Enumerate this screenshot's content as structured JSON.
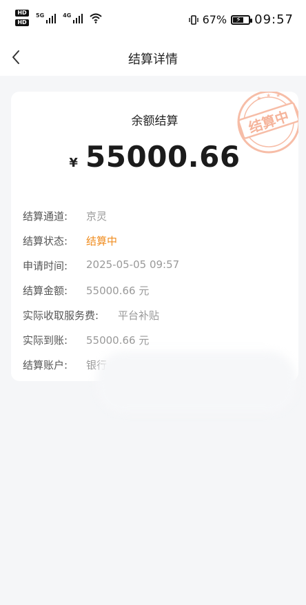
{
  "status_bar": {
    "sim1": "HD",
    "sim2": "HD",
    "net1": "5G",
    "net2": "4G",
    "battery_percent": "67%",
    "battery_level": 0.67,
    "time": "09:57"
  },
  "header": {
    "title": "结算详情",
    "back_icon": "chevron-left-icon"
  },
  "card": {
    "heading": "余额结算",
    "currency_symbol": "¥",
    "amount": "55000.66",
    "stamp_text": "结算中",
    "stamp_color": "#f4a78a"
  },
  "details": [
    {
      "label": "结算通道:",
      "value": "京灵"
    },
    {
      "label": "结算状态:",
      "value": "结算中"
    },
    {
      "label": "申请时间:",
      "value": "2025-05-05 09:57"
    },
    {
      "label": "结算金额:",
      "value": "55000.66 元"
    },
    {
      "label": "实际收取服务费:",
      "value": "平台补贴"
    },
    {
      "label": "实际到账:",
      "value": "55000.66 元"
    },
    {
      "label": "结算账户:",
      "value": "银行"
    }
  ],
  "colors": {
    "status_accent": "#f08c1e",
    "background": "#f5f6f8"
  }
}
